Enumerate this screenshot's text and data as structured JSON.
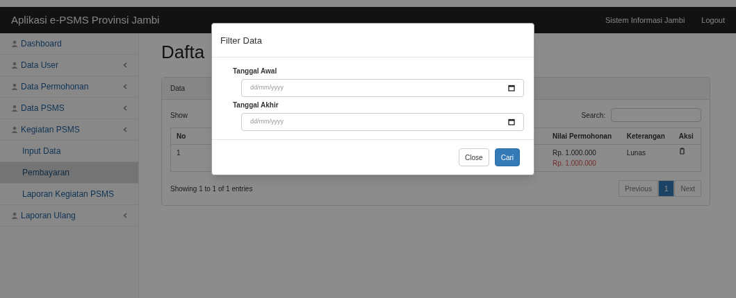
{
  "navbar": {
    "title": "Aplikasi e-PSMS Provinsi Jambi",
    "links": [
      "Sistem Informasi Jambi",
      "Logout"
    ]
  },
  "sidebar": {
    "items": [
      {
        "label": "Dashboard",
        "expandable": false
      },
      {
        "label": "Data User",
        "expandable": true
      },
      {
        "label": "Data Permohonan",
        "expandable": true
      },
      {
        "label": "Data PSMS",
        "expandable": true
      },
      {
        "label": "Kegiatan PSMS",
        "expandable": true,
        "children": [
          {
            "label": "Input Data",
            "selected": false
          },
          {
            "label": "Pembayaran",
            "selected": true
          },
          {
            "label": "Laporan Kegiatan PSMS",
            "selected": false
          }
        ]
      },
      {
        "label": "Laporan Ulang",
        "expandable": true
      }
    ]
  },
  "page": {
    "heading": "Dafta",
    "panel_heading": "Data",
    "show_label": "Show",
    "search_label": "Search:",
    "table": {
      "columns": [
        "No",
        "Nilai Permohonan",
        "Keterangan",
        "Aksi"
      ],
      "rows": [
        {
          "no": "1",
          "value": "Rp. 1.000.000",
          "note": "Lunas",
          "status": "Rp. 1.000.000"
        }
      ]
    },
    "info": "Showing 1 to 1 of 1 entries",
    "pagination": [
      {
        "label": "Previous",
        "selected": false
      },
      {
        "label": "1",
        "selected": true
      },
      {
        "label": "Next",
        "selected": false
      }
    ]
  },
  "modal": {
    "title": "Filter Data",
    "fields": [
      {
        "label": "Tanggal Awal",
        "placeholder": "dd/mm/yyyy"
      },
      {
        "label": "Tanggal Akhir",
        "placeholder": "dd/mm/yyyy"
      }
    ],
    "buttons": [
      {
        "label": "Close",
        "kind": "default"
      },
      {
        "label": "Cari",
        "kind": "primary"
      }
    ]
  }
}
